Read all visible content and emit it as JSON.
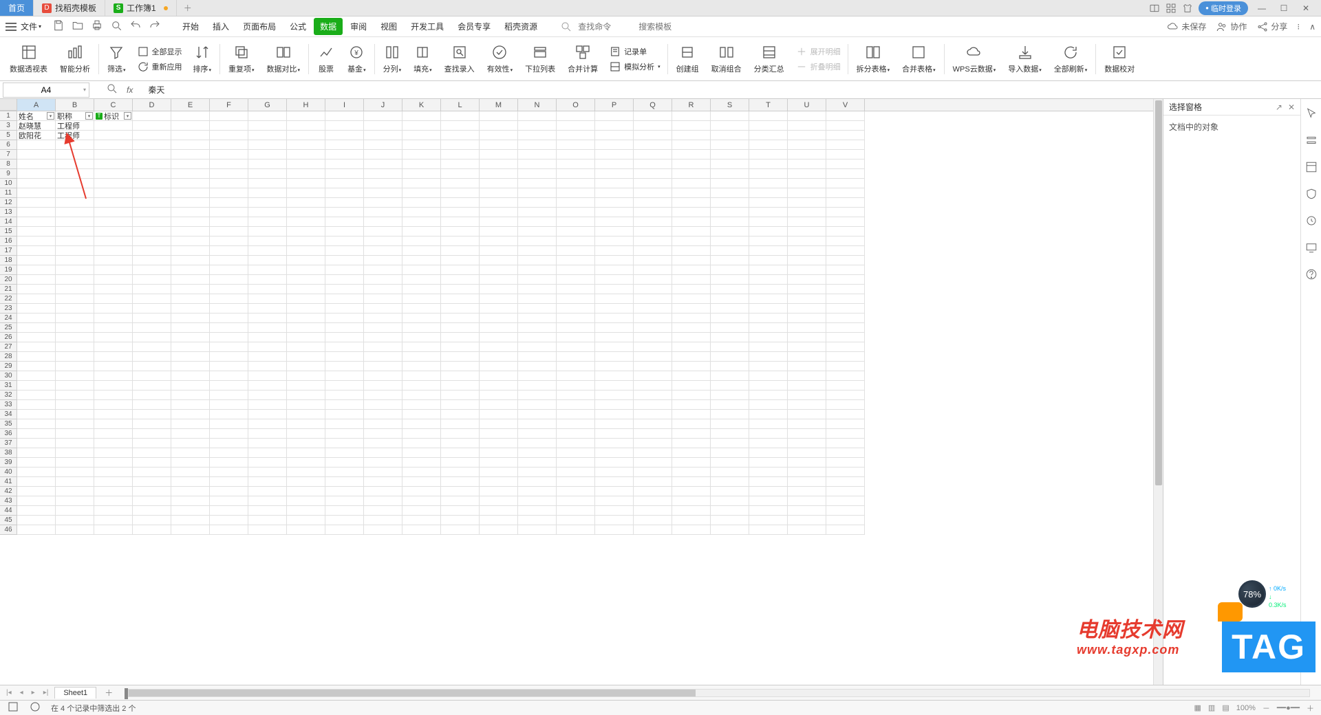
{
  "titleTabs": {
    "home": "首页",
    "template": "找稻壳模板",
    "workbook": "工作簿1"
  },
  "titleRight": {
    "login": "临时登录"
  },
  "menuBar": {
    "file": "文件",
    "tabs": [
      "开始",
      "插入",
      "页面布局",
      "公式",
      "数据",
      "审阅",
      "视图",
      "开发工具",
      "会员专享",
      "稻壳资源"
    ],
    "activeTab": "数据",
    "searchCmd": "查找命令",
    "searchTpl": "搜索模板",
    "unsaved": "未保存",
    "coop": "协作",
    "share": "分享"
  },
  "ribbon": {
    "pivot": "数据透视表",
    "smart": "智能分析",
    "filter": "筛选",
    "showAll": "全部显示",
    "reapply": "重新应用",
    "sort": "排序",
    "dup": "重复项",
    "dataCompare": "数据对比",
    "stock": "股票",
    "fund": "基金",
    "splitCol": "分列",
    "fill": "填充",
    "findEntry": "查找录入",
    "validity": "有效性",
    "dropList": "下拉列表",
    "mergeCalc": "合并计算",
    "recordForm": "记录单",
    "simAnalysis": "模拟分析",
    "createGroup": "创建组",
    "ungroup": "取消组合",
    "subtotal": "分类汇总",
    "expandDetail": "展开明细",
    "collapseDetail": "折叠明细",
    "splitTable": "拆分表格",
    "mergeTable": "合并表格",
    "wpsCloud": "WPS云数据",
    "importData": "导入数据",
    "refreshAll": "全部刷新",
    "dataCheck": "数据校对"
  },
  "nameBox": "A4",
  "formulaBar": "秦天",
  "colHeaders": [
    "A",
    "B",
    "C",
    "D",
    "E",
    "F",
    "G",
    "H",
    "I",
    "J",
    "K",
    "L",
    "M",
    "N",
    "O",
    "P",
    "Q",
    "R",
    "S",
    "T",
    "U",
    "V"
  ],
  "rowNumbers": [
    1,
    3,
    5,
    6,
    7,
    8,
    9,
    10,
    11,
    12,
    13,
    14,
    15,
    16,
    17,
    18,
    19,
    20,
    21,
    22,
    23,
    24,
    25,
    26,
    27,
    28,
    29,
    30,
    31,
    32,
    33,
    34,
    35,
    36,
    37,
    38,
    39,
    40,
    41,
    42,
    43,
    44,
    45,
    46
  ],
  "gridData": {
    "header": {
      "a": "姓名",
      "b": "职称",
      "c": "标识"
    },
    "rows": [
      {
        "a": "赵晓慧",
        "b": "工程师",
        "c": ""
      },
      {
        "a": "欧阳花",
        "b": "工程师",
        "c": ""
      }
    ]
  },
  "selectionPane": {
    "title": "选择窗格",
    "body": "文档中的对象"
  },
  "sheetTabs": {
    "sheet1": "Sheet1"
  },
  "statusBar": {
    "filterMsg": "在 4 个记录中筛选出 2 个",
    "zoom": "100%"
  },
  "watermark": {
    "line1": "电脑技术网",
    "line2": "www.tagxp.com",
    "tag": "TAG"
  },
  "netBadge": {
    "pct": "78%",
    "up": "0K/s",
    "down": "0.3K/s"
  }
}
